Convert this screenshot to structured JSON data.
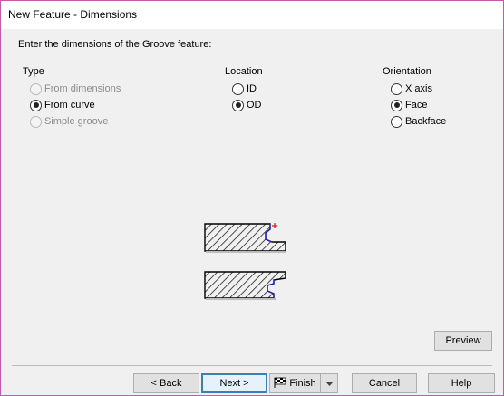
{
  "window": {
    "title": "New Feature - Dimensions"
  },
  "prompt": "Enter the dimensions of the Groove feature:",
  "type": {
    "label": "Type",
    "options": [
      {
        "label": "From dimensions",
        "checked": false,
        "enabled": false
      },
      {
        "label": "From curve",
        "checked": true,
        "enabled": true
      },
      {
        "label": "Simple groove",
        "checked": false,
        "enabled": false
      }
    ]
  },
  "location": {
    "label": "Location",
    "options": [
      {
        "label": "ID",
        "checked": false,
        "enabled": true
      },
      {
        "label": "OD",
        "checked": true,
        "enabled": true
      }
    ]
  },
  "orientation": {
    "label": "Orientation",
    "options": [
      {
        "label": "X axis",
        "checked": false,
        "enabled": true
      },
      {
        "label": "Face",
        "checked": true,
        "enabled": true
      },
      {
        "label": "Backface",
        "checked": false,
        "enabled": true
      }
    ]
  },
  "buttons": {
    "preview": "Preview",
    "back": "< Back",
    "next": "Next >",
    "finish": "Finish",
    "cancel": "Cancel",
    "help": "Help"
  },
  "icons": {
    "finish": "checkered-flag-icon",
    "finish_dropdown": "chevron-down-icon"
  },
  "colors": {
    "window_border": "#c45aa8",
    "default_button_border": "#3c7fb1",
    "profile_edge": "#1a1adb",
    "marker": "#e01010"
  }
}
